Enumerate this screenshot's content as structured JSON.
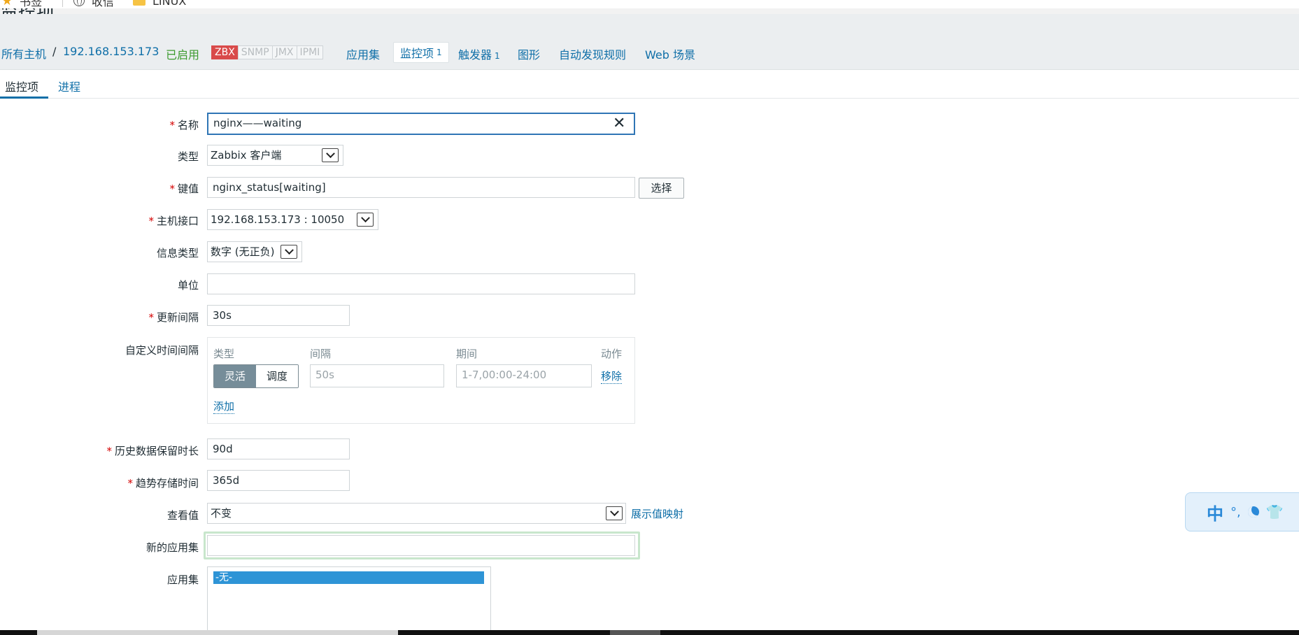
{
  "bookmarks": {
    "items": [
      {
        "label": "书签",
        "icon": "star-icon"
      },
      {
        "label": "收信",
        "icon": "globe-icon"
      },
      {
        "label": "LINUX",
        "icon": "folder-icon"
      }
    ]
  },
  "page": {
    "title": "监控项"
  },
  "hostnav": {
    "breadcrumb_all": "所有主机",
    "breadcrumb_sep": "/",
    "host": "192.168.153.173",
    "status": "已启用",
    "protocols": [
      "ZBX",
      "SNMP",
      "JMX",
      "IPMI"
    ],
    "links": {
      "applications": "应用集",
      "items": "监控项",
      "items_count": "1",
      "triggers": "触发器",
      "triggers_count": "1",
      "graphs": "图形",
      "discovery": "自动发现规则",
      "web": "Web 场景"
    },
    "colors": {
      "link": "#0f6fa8",
      "enabled": "#3c9b2e",
      "zbx_badge": "#d94a4a"
    }
  },
  "subtabs": {
    "items": "监控项",
    "process": "进程"
  },
  "form": {
    "required_mark": "*",
    "name": {
      "label": "名称",
      "value": "nginx——waiting"
    },
    "type": {
      "label": "类型",
      "value": "Zabbix 客户端"
    },
    "key": {
      "label": "键值",
      "value": "nginx_status[waiting]",
      "select_button": "选择"
    },
    "interface": {
      "label": "主机接口",
      "value": "192.168.153.173 : 10050"
    },
    "info_type": {
      "label": "信息类型",
      "value": "数字 (无正负)"
    },
    "units": {
      "label": "单位",
      "value": ""
    },
    "update_interval": {
      "label": "更新间隔",
      "value": "30s"
    },
    "custom_intervals": {
      "label": "自定义时间间隔",
      "headers": {
        "type": "类型",
        "interval": "间隔",
        "period": "期间",
        "action": "动作"
      },
      "mode_flexible": "灵活",
      "mode_scheduling": "调度",
      "interval_placeholder": "50s",
      "period_placeholder": "1-7,00:00-24:00",
      "remove": "移除",
      "add": "添加"
    },
    "history": {
      "label": "历史数据保留时长",
      "value": "90d"
    },
    "trends": {
      "label": "趋势存储时间",
      "value": "365d"
    },
    "valuemap": {
      "label": "查看值",
      "value": "不变",
      "link": "展示值映射"
    },
    "new_application": {
      "label": "新的应用集",
      "value": ""
    },
    "applications": {
      "label": "应用集",
      "options": [
        "-无-"
      ]
    }
  },
  "ime": {
    "lang": "中",
    "punct": "°,",
    "icons": [
      "moon-icon",
      "shirt-icon"
    ]
  }
}
